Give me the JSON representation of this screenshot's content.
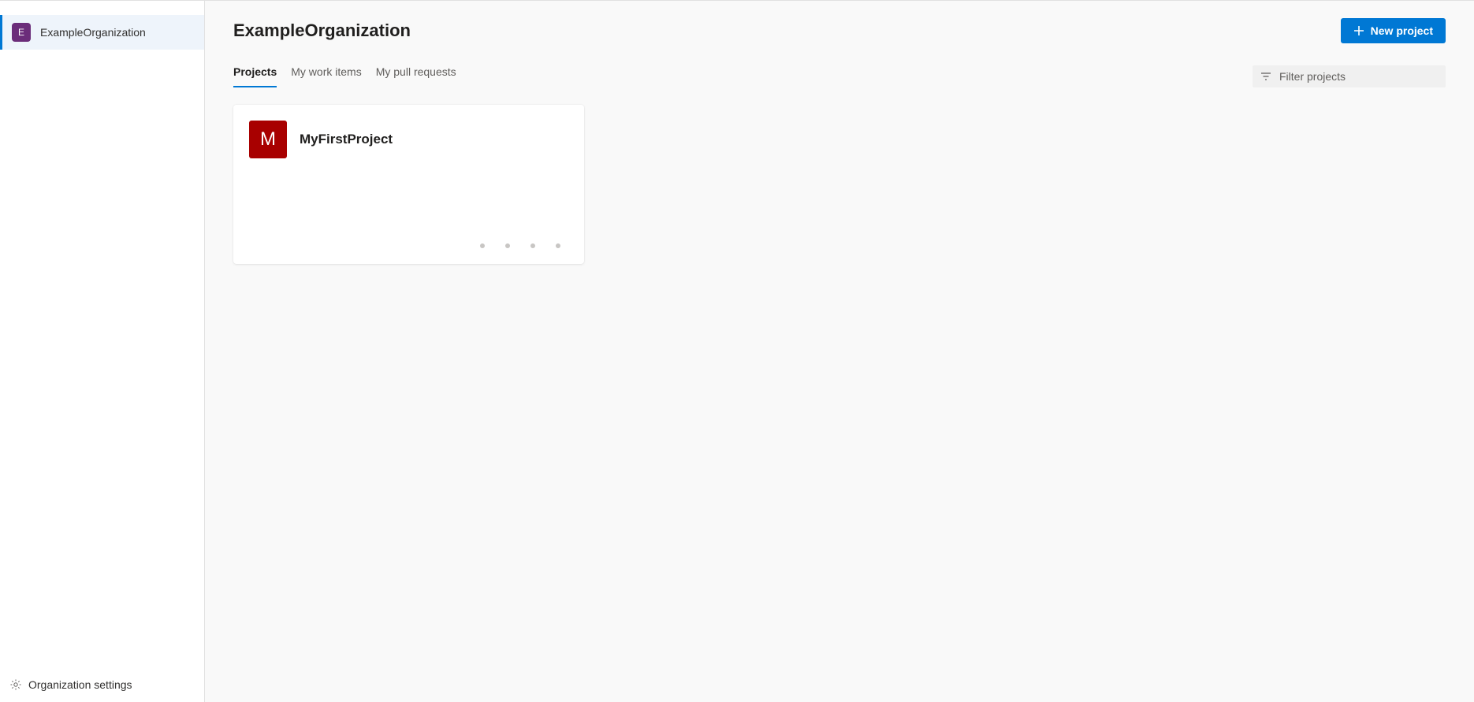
{
  "sidebar": {
    "org_avatar_letter": "E",
    "org_name": "ExampleOrganization",
    "settings_label": "Organization settings"
  },
  "header": {
    "title": "ExampleOrganization",
    "new_project_label": "New project"
  },
  "tabs": {
    "projects": "Projects",
    "work_items": "My work items",
    "pull_requests": "My pull requests"
  },
  "filter": {
    "placeholder": "Filter projects"
  },
  "projects": [
    {
      "avatar_letter": "M",
      "name": "MyFirstProject",
      "avatar_color": "#a80000"
    }
  ]
}
